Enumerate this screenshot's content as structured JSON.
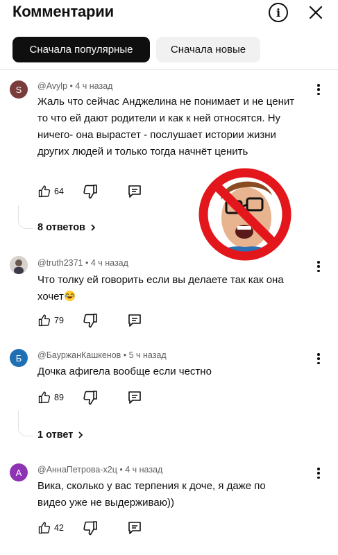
{
  "header": {
    "title": "Комментарии",
    "info_icon": "info-icon",
    "close_icon": "close-icon"
  },
  "sort": {
    "popular": "Сначала популярные",
    "newest": "Сначала новые"
  },
  "comments": [
    {
      "avatar_letter": "S",
      "avatar_color": "#7a3b3b",
      "meta": "@Avylp • 4 ч назад",
      "text": "Жаль что сейчас Анджелина не понимает и не ценит то что ей дают родители и как к ней относятся. Ну ничего- она вырастет - послушает истории жизни других людей и только тогда начнёт ценить",
      "likes": "64",
      "replies": "8 ответов"
    },
    {
      "avatar_letter": "",
      "avatar_color": "#c9c3bf",
      "meta": "@truth2371 • 4 ч назад",
      "text": "Что толку ей говорить если вы делаете так как она хочет",
      "likes": "79"
    },
    {
      "avatar_letter": "Б",
      "avatar_color": "#1f6fb5",
      "meta": "@БауржанКашкенов • 5 ч назад",
      "text": "Дочка афигела вообще если честно",
      "likes": "89",
      "replies": "1 ответ"
    },
    {
      "avatar_letter": "А",
      "avatar_color": "#8e33b4",
      "meta": "@АннаПетрова-х2ц • 4 ч назад",
      "text": "Вика, сколько у вас терпения к доче, я даже по видео уже не выдерживаю))",
      "likes": "42"
    }
  ],
  "icons": {
    "like": "thumb-up-icon",
    "dislike": "thumb-down-icon",
    "reply": "reply-icon",
    "more": "more-vert-icon",
    "chevron": "chevron-right-icon"
  },
  "colors": {
    "prohibition_red": "#e3161b",
    "chip_active": "#0f0f0f",
    "chip_inactive": "#f1f1f1"
  }
}
